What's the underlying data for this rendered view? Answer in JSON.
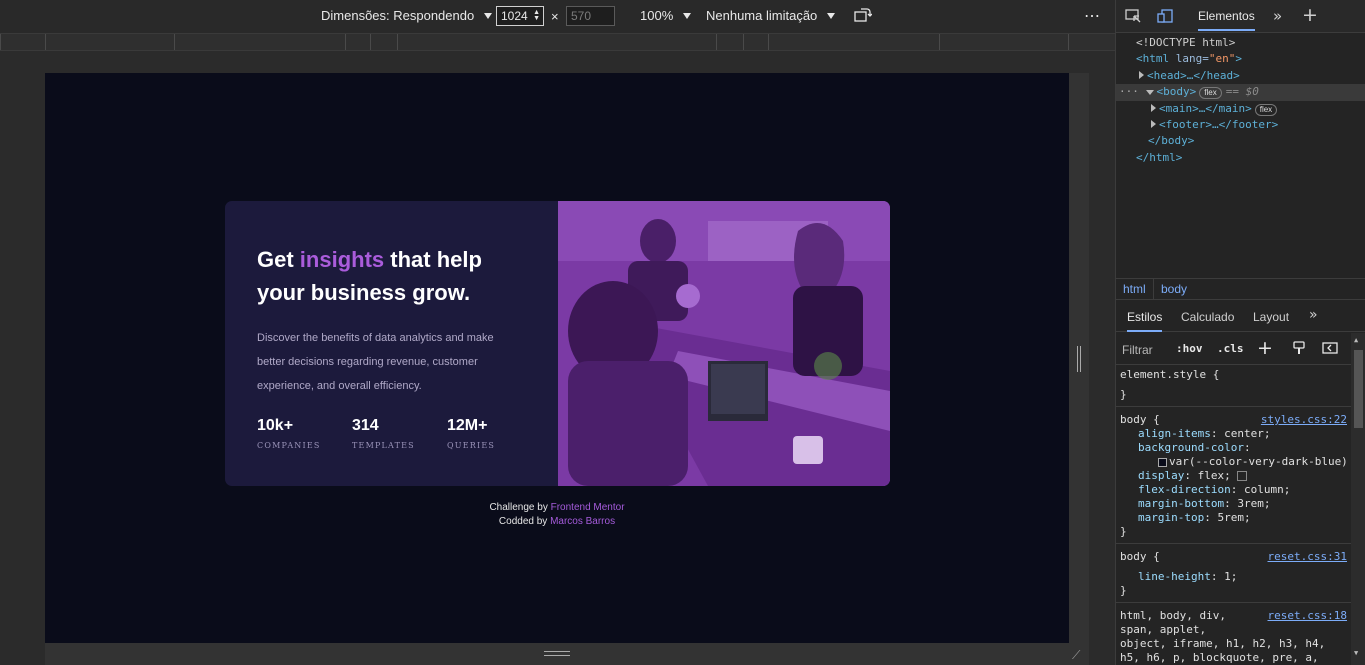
{
  "device_toolbar": {
    "dimensions_label": "Dimensões: Respondendo",
    "width_value": "1024",
    "height_value": "570",
    "times_sign": "×",
    "zoom_label": "100%",
    "throttle_label": "Nenhuma limitação",
    "more_icon": "more-options-icon",
    "rotate_icon": "rotate-icon"
  },
  "page": {
    "title_before": "Get ",
    "title_accent": "insights",
    "title_after_line1": " that help",
    "title_line2": "your business grow.",
    "description": "Discover the benefits of data analytics and make better decisions regarding revenue, customer experience, and overall efficiency.",
    "stats": [
      {
        "number": "10k+",
        "label": "COMPANIES"
      },
      {
        "number": "314",
        "label": "TEMPLATES"
      },
      {
        "number": "12M+",
        "label": "QUERIES"
      }
    ],
    "footer_line1_prefix": "Challenge by ",
    "footer_line1_link": "Frontend Mentor",
    "footer_line2_prefix": "Codded by ",
    "footer_line2_link": "Marcos Barros"
  },
  "devtools": {
    "tab_elements": "Elementos",
    "dom": {
      "doctype": "<!DOCTYPE html>",
      "html_open_tag": "<html",
      "html_attr_name": " lang=",
      "html_attr_value": "\"en\"",
      "html_open_close": ">",
      "head": "<head>…</head>",
      "body_open": "<body>",
      "body_badge": "flex",
      "body_eq": "== $0",
      "main": "<main>…</main>",
      "main_badge": "flex",
      "footer": "<footer>…</footer>",
      "body_close": "</body>",
      "html_close": "</html>"
    },
    "breadcrumbs": [
      "html",
      "body"
    ],
    "styles_tabs": [
      "Estilos",
      "Calculado",
      "Layout"
    ],
    "filter_placeholder": "Filtrar",
    "hov": ":hov",
    "cls": ".cls",
    "rules": {
      "element_style_open": "element.style {",
      "close": "}",
      "body_selector": "body {",
      "body_source": "styles.css:22",
      "body_props": [
        {
          "name": "align-items",
          "value": "center;"
        },
        {
          "name": "background-color",
          "value": ""
        },
        {
          "name": "display",
          "value": "flex;"
        },
        {
          "name": "flex-direction",
          "value": "column;"
        },
        {
          "name": "margin-bottom",
          "value": "3rem;"
        },
        {
          "name": "margin-top",
          "value": "5rem;"
        }
      ],
      "bg_value": "var(--color-very-dark-blue)",
      "reset_selector": "body {",
      "reset_source": "reset.css:31",
      "reset_prop_name": "line-height",
      "reset_prop_value": "1;",
      "reset2_source": "reset.css:18",
      "reset2_lines": [
        "html, body, div,",
        "span, applet,",
        "object, iframe, h1, h2, h3, h4,",
        "h5, h6, p, blockquote, pre, a,"
      ]
    }
  }
}
